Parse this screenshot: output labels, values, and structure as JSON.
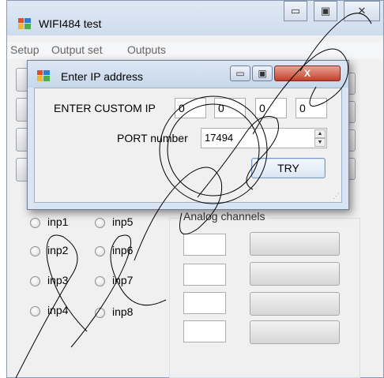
{
  "main_window": {
    "title": "WIFI484 test",
    "minimize_glyph": "▭",
    "maximize_glyph": "▣",
    "close_glyph": "✕",
    "menu": [
      "Setup",
      "Output set",
      "Outputs"
    ]
  },
  "inputs": {
    "items": [
      "inp1",
      "inp5",
      "inp2",
      "inp6",
      "inp3",
      "inp7",
      "inp4",
      "inp8"
    ]
  },
  "analog": {
    "title": "Analog channels"
  },
  "dialog": {
    "title": "Enter IP address",
    "minimize_glyph": "▭",
    "maximize_glyph": "▣",
    "close_glyph": "X",
    "ip_label": "ENTER CUSTOM IP",
    "ip": [
      "0",
      "0",
      "0",
      "0"
    ],
    "port_label": "PORT number",
    "port_value": "17494",
    "try_label": "TRY",
    "spin_up": "▲",
    "spin_down": "▼"
  },
  "colors": {
    "window_bg": "#f0f0f0",
    "titlebar": "#d0ddec",
    "close_red": "#c4402c"
  }
}
